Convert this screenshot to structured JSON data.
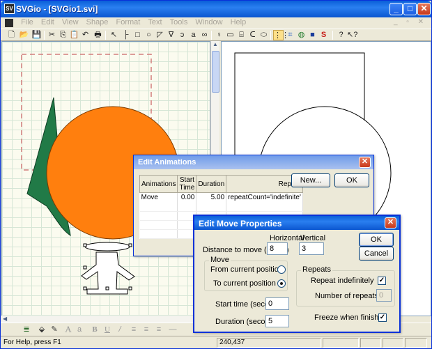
{
  "window": {
    "title": "SVGio - [SVGio1.svi]",
    "app_icon_text": "SV"
  },
  "menu": [
    "File",
    "Edit",
    "View",
    "Shape",
    "Format",
    "Text",
    "Tools",
    "Window",
    "Help"
  ],
  "toolbar": {
    "icons": [
      "new-icon",
      "open-icon",
      "save-icon",
      "cut-icon",
      "copy-icon",
      "paste-icon",
      "undo-icon",
      "print-icon",
      "pointer-icon",
      "line-icon",
      "rect-icon",
      "circle-icon",
      "polygon-icon",
      "path-icon",
      "arc-icon",
      "text-tool-icon",
      "link-icon",
      "person-icon",
      "rect-tool-icon",
      "cylinder-icon",
      "bracket-icon",
      "ellipse-icon",
      "grid-icon",
      "snap-icon",
      "globe-icon",
      "save-web-icon",
      "svg-s-icon",
      "help-icon",
      "whats-this-icon"
    ]
  },
  "status": {
    "help_text": "For Help, press F1",
    "coordinates": "240,437"
  },
  "edit_animations": {
    "title": "Edit Animations",
    "columns": [
      "Animations",
      "Start Time",
      "Duration",
      "Repeat"
    ],
    "rows": [
      {
        "animation": "Move",
        "start": "0.00",
        "duration": "5.00",
        "repeat": "repeatCount='indefinite'"
      }
    ],
    "new_label": "New...",
    "ok_label": "OK"
  },
  "edit_move": {
    "title": "Edit Move Properties",
    "horizontal_label": "Horizontal",
    "vertical_label": "Vertical",
    "distance_label": "Distance to move (pixels)",
    "horizontal_value": "8",
    "vertical_value": "3",
    "ok_label": "OK",
    "cancel_label": "Cancel",
    "move_group": "Move",
    "from_current": "From current position",
    "to_current": "To current position",
    "repeats_group": "Repeats",
    "repeat_indefinitely": "Repeat indefinitely",
    "number_of_repeats": "Number of repeats",
    "repeats_value": "0",
    "start_time_label": "Start time (seconds)",
    "start_time_value": "0",
    "duration_label": "Duration (seconds)",
    "duration_value": "5",
    "freeze_label": "Freeze when finished"
  },
  "colors": {
    "title_blue": "#0a5fd8",
    "orange_circle": "#ff7f0e",
    "green_shape": "#217a47"
  }
}
